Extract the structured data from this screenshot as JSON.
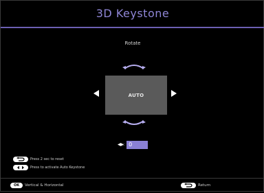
{
  "window": {
    "title": "3D Keystone"
  },
  "mode": {
    "label": "Rotate"
  },
  "screen": {
    "label": "AUTO"
  },
  "value": {
    "current": "0"
  },
  "hints": {
    "reset_text": "Press 2 sec to reset",
    "auto_text": "Press to activate Auto Keystone"
  },
  "footer": {
    "ok_label": "OK",
    "ok_text": "Vertical & Horizontal",
    "return_text": "Return"
  },
  "colors": {
    "accent": "#8f86d6",
    "value_box": "#8a80d4",
    "screen": "#5a5a5a",
    "background": "#000000"
  },
  "icons": [
    "rotate-arc-icon",
    "left-arrow-icon",
    "right-arrow-icon",
    "back-key-icon",
    "left-right-key-icon",
    "return-key-icon"
  ]
}
